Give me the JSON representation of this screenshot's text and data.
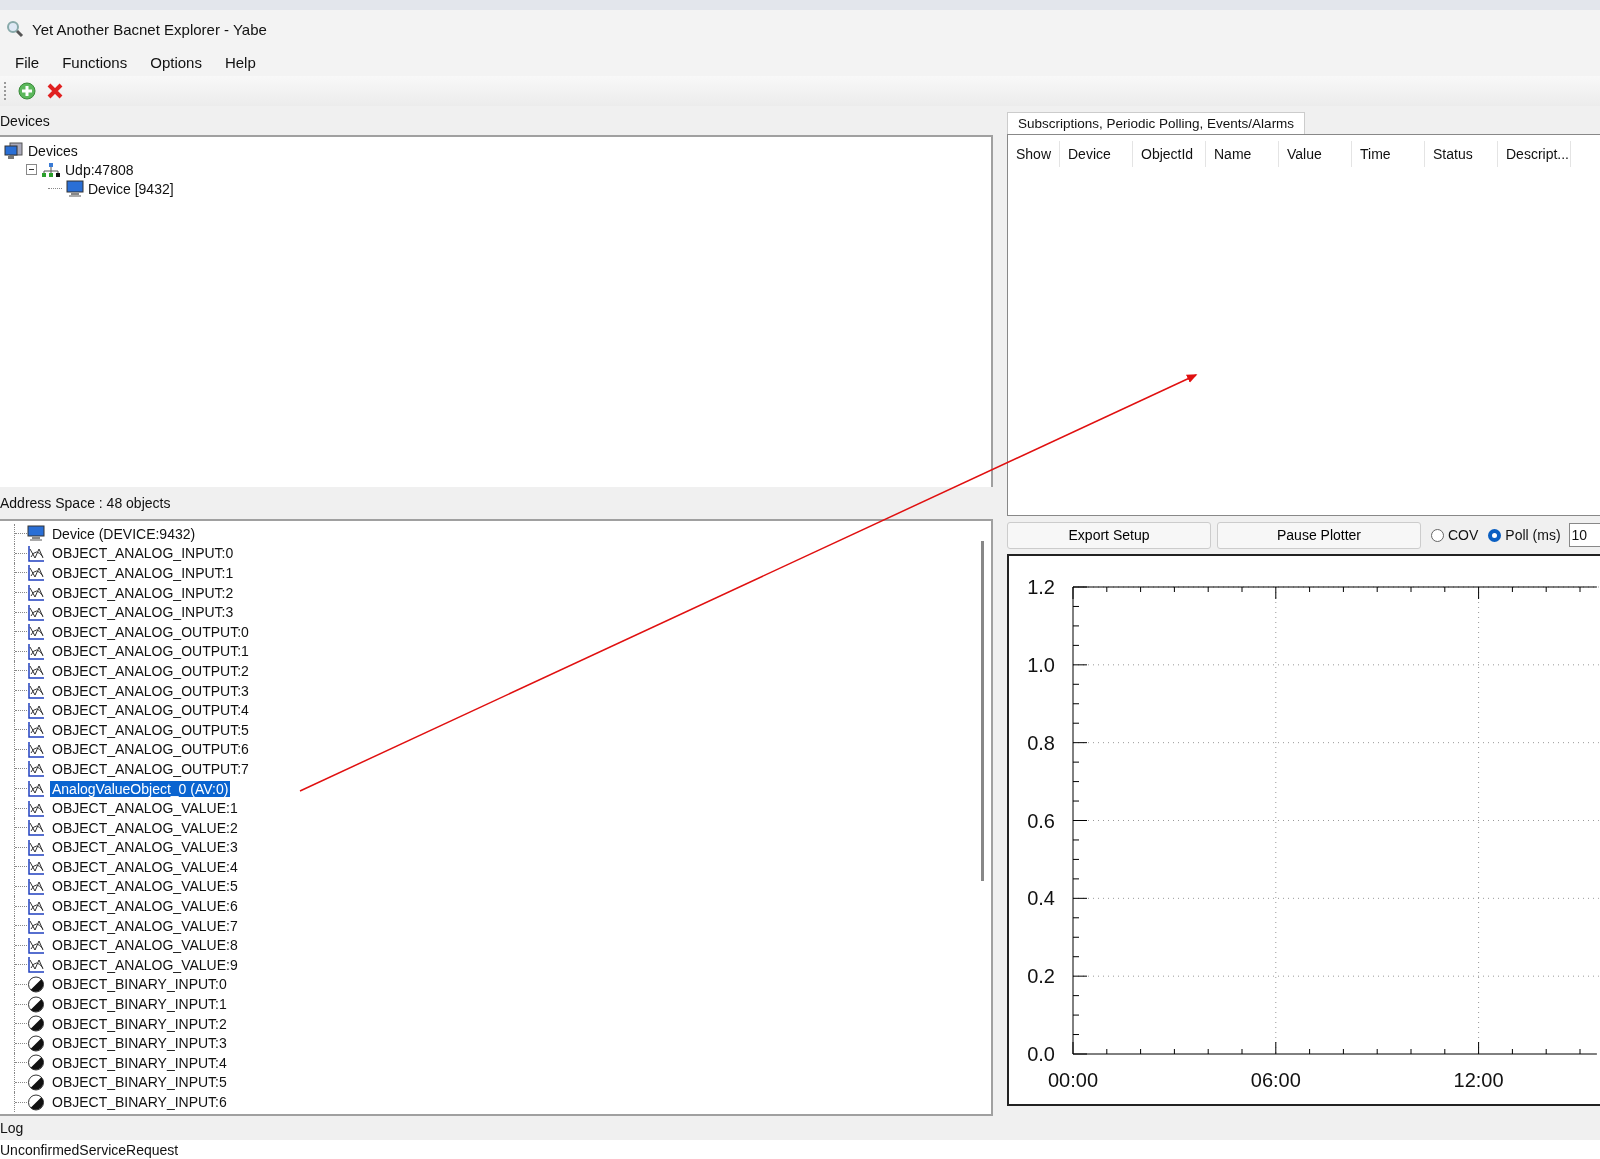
{
  "window": {
    "title": "Yet Another Bacnet Explorer - Yabe"
  },
  "menu": [
    "File",
    "Functions",
    "Options",
    "Help"
  ],
  "toolbar": [
    {
      "kind": "add"
    },
    {
      "kind": "remove"
    }
  ],
  "devices": {
    "header": "Devices",
    "tree": [
      {
        "label": "Devices",
        "kind": "root",
        "children": [
          {
            "label": "Udp:47808",
            "kind": "network",
            "expanded": true,
            "children": [
              {
                "label": "Device [9432]",
                "kind": "device"
              }
            ]
          }
        ]
      }
    ]
  },
  "address_space": {
    "header": "Address Space : 48 objects",
    "items": [
      {
        "label": "Device (DEVICE:9432)",
        "kind": "device",
        "selected": false
      },
      {
        "label": "OBJECT_ANALOG_INPUT:0",
        "kind": "analog",
        "selected": false
      },
      {
        "label": "OBJECT_ANALOG_INPUT:1",
        "kind": "analog",
        "selected": false
      },
      {
        "label": "OBJECT_ANALOG_INPUT:2",
        "kind": "analog",
        "selected": false
      },
      {
        "label": "OBJECT_ANALOG_INPUT:3",
        "kind": "analog",
        "selected": false
      },
      {
        "label": "OBJECT_ANALOG_OUTPUT:0",
        "kind": "analog",
        "selected": false
      },
      {
        "label": "OBJECT_ANALOG_OUTPUT:1",
        "kind": "analog",
        "selected": false
      },
      {
        "label": "OBJECT_ANALOG_OUTPUT:2",
        "kind": "analog",
        "selected": false
      },
      {
        "label": "OBJECT_ANALOG_OUTPUT:3",
        "kind": "analog",
        "selected": false
      },
      {
        "label": "OBJECT_ANALOG_OUTPUT:4",
        "kind": "analog",
        "selected": false
      },
      {
        "label": "OBJECT_ANALOG_OUTPUT:5",
        "kind": "analog",
        "selected": false
      },
      {
        "label": "OBJECT_ANALOG_OUTPUT:6",
        "kind": "analog",
        "selected": false
      },
      {
        "label": "OBJECT_ANALOG_OUTPUT:7",
        "kind": "analog",
        "selected": false
      },
      {
        "label": "AnalogValueObject_0 (AV:0)",
        "kind": "analog",
        "selected": true
      },
      {
        "label": "OBJECT_ANALOG_VALUE:1",
        "kind": "analog",
        "selected": false
      },
      {
        "label": "OBJECT_ANALOG_VALUE:2",
        "kind": "analog",
        "selected": false
      },
      {
        "label": "OBJECT_ANALOG_VALUE:3",
        "kind": "analog",
        "selected": false
      },
      {
        "label": "OBJECT_ANALOG_VALUE:4",
        "kind": "analog",
        "selected": false
      },
      {
        "label": "OBJECT_ANALOG_VALUE:5",
        "kind": "analog",
        "selected": false
      },
      {
        "label": "OBJECT_ANALOG_VALUE:6",
        "kind": "analog",
        "selected": false
      },
      {
        "label": "OBJECT_ANALOG_VALUE:7",
        "kind": "analog",
        "selected": false
      },
      {
        "label": "OBJECT_ANALOG_VALUE:8",
        "kind": "analog",
        "selected": false
      },
      {
        "label": "OBJECT_ANALOG_VALUE:9",
        "kind": "analog",
        "selected": false
      },
      {
        "label": "OBJECT_BINARY_INPUT:0",
        "kind": "binary",
        "selected": false
      },
      {
        "label": "OBJECT_BINARY_INPUT:1",
        "kind": "binary",
        "selected": false
      },
      {
        "label": "OBJECT_BINARY_INPUT:2",
        "kind": "binary",
        "selected": false
      },
      {
        "label": "OBJECT_BINARY_INPUT:3",
        "kind": "binary",
        "selected": false
      },
      {
        "label": "OBJECT_BINARY_INPUT:4",
        "kind": "binary",
        "selected": false
      },
      {
        "label": "OBJECT_BINARY_INPUT:5",
        "kind": "binary",
        "selected": false
      },
      {
        "label": "OBJECT_BINARY_INPUT:6",
        "kind": "binary",
        "selected": false
      }
    ]
  },
  "subscriptions": {
    "tab": {
      "label": "Subscriptions, Periodic Polling, Events/Alarms",
      "selected": true
    },
    "columns": [
      "Show",
      "Device",
      "ObjectId",
      "Name",
      "Value",
      "Time",
      "Status",
      "Descript..."
    ]
  },
  "plotter": {
    "buttons": [
      "Export Setup",
      "Pause Plotter"
    ],
    "modes": [
      {
        "label": "COV",
        "selected": false
      },
      {
        "label": "Poll (ms)",
        "selected": true
      }
    ],
    "poll_value": "10",
    "chart_data": {
      "type": "line",
      "grid": true,
      "xlim": [
        0,
        15.5
      ],
      "ylim": [
        0,
        1.2
      ],
      "xticks": [
        {
          "value": 0,
          "label": "00:00"
        },
        {
          "value": 6,
          "label": "06:00"
        },
        {
          "value": 12,
          "label": "12:00"
        }
      ],
      "yticks": [
        {
          "value": 0,
          "label": "0.0"
        },
        {
          "value": 0.2,
          "label": "0.2"
        },
        {
          "value": 0.4,
          "label": "0.4"
        },
        {
          "value": 0.6,
          "label": "0.6"
        },
        {
          "value": 0.8,
          "label": "0.8"
        },
        {
          "value": 1.0,
          "label": "1.0"
        },
        {
          "value": 1.2,
          "label": "1.2"
        }
      ]
    }
  },
  "log": {
    "header": "Log",
    "lines": [
      "UnconfirmedServiceRequest"
    ]
  }
}
